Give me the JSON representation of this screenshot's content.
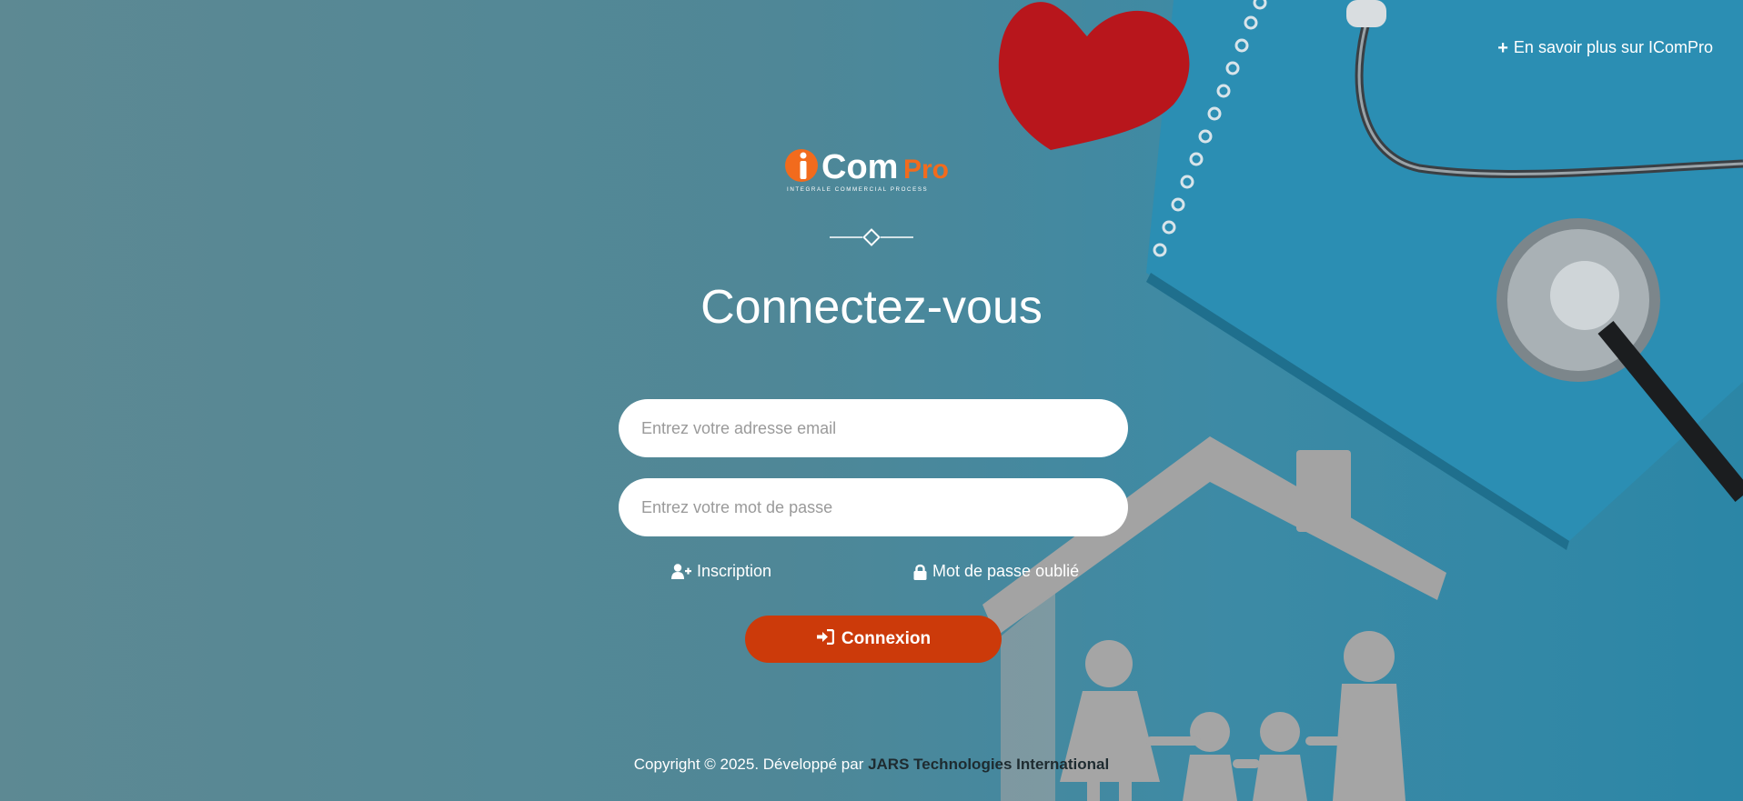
{
  "header": {
    "learn_more_label": "En savoir plus sur IComPro"
  },
  "logo": {
    "brand_main": "Com",
    "brand_suffix": "Pro",
    "tagline": "INTEGRALE COMMERCIAL PROCESS"
  },
  "login": {
    "title": "Connectez-vous",
    "email_placeholder": "Entrez votre adresse email",
    "password_placeholder": "Entrez votre mot de passe",
    "register_label": "Inscription",
    "forgot_label": "Mot de passe oublié",
    "submit_label": "Connexion"
  },
  "footer": {
    "copyright_text": "Copyright © 2025. Développé par ",
    "company_name": "JARS Technologies International"
  },
  "colors": {
    "accent": "#cc3a0a",
    "logo_orange": "#f26b1d",
    "background": "#4f8797"
  },
  "icons": {
    "learn_more": "plus-icon",
    "register": "user-plus-icon",
    "forgot": "lock-icon",
    "submit": "sign-in-icon"
  }
}
